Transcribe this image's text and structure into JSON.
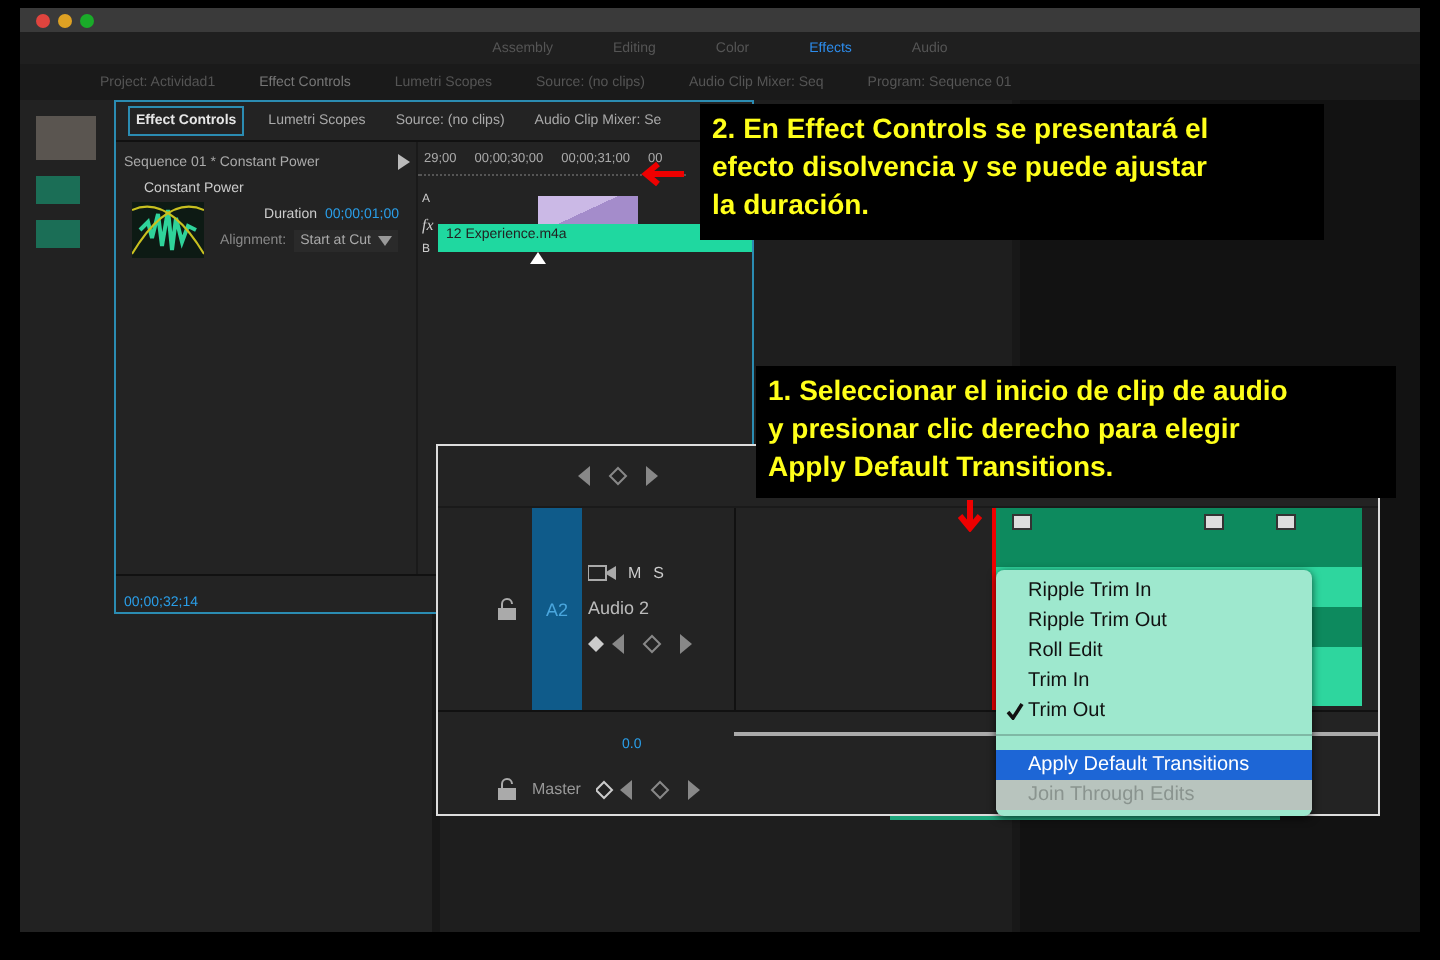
{
  "workspace_tabs": [
    {
      "label": "Assembly",
      "selected": false
    },
    {
      "label": "Editing",
      "selected": false
    },
    {
      "label": "Color",
      "selected": false
    },
    {
      "label": "Effects",
      "selected": true
    },
    {
      "label": "Audio",
      "selected": false
    }
  ],
  "background_tabs": [
    {
      "label": "Project: Actividad1",
      "selected": false
    },
    {
      "label": "Effect Controls",
      "selected": true
    },
    {
      "label": "Lumetri Scopes",
      "selected": false
    },
    {
      "label": "Source: (no clips)",
      "selected": false
    },
    {
      "label": "Audio Clip Mixer: Seq",
      "selected": false
    },
    {
      "label": "Program: Sequence 01",
      "selected": false
    }
  ],
  "effect_controls": {
    "tabs": [
      {
        "label": "Effect Controls",
        "selected": true
      },
      {
        "label": "Lumetri Scopes",
        "selected": false
      },
      {
        "label": "Source: (no clips)",
        "selected": false
      },
      {
        "label": "Audio Clip Mixer: Se",
        "selected": false
      }
    ],
    "sequence": "Sequence 01 * Constant Power",
    "ruler": [
      "29;00",
      "00;00;30;00",
      "00;00;31;00",
      "00"
    ],
    "effect_name": "Constant Power",
    "duration_label": "Duration",
    "duration": "00;00;01;00",
    "alignment_label": "Alignment:",
    "alignment": "Start at Cut",
    "track_labels": [
      "A",
      "fx",
      "B"
    ],
    "clip": "12 Experience.m4a",
    "timecode": "00;00;32;14"
  },
  "timeline": {
    "track_id": "A2",
    "track_name": "Audio 2",
    "toggles": [
      "M",
      "S"
    ],
    "master_value": "0.0",
    "master_name": "Master"
  },
  "context_menu": [
    {
      "label": "Ripple Trim In",
      "checked": false,
      "selected": false,
      "disabled": false
    },
    {
      "label": "Ripple Trim Out",
      "checked": false,
      "selected": false,
      "disabled": false
    },
    {
      "label": "Roll Edit",
      "checked": false,
      "selected": false,
      "disabled": false
    },
    {
      "label": "Trim In",
      "checked": false,
      "selected": false,
      "disabled": false
    },
    {
      "label": "Trim Out",
      "checked": true,
      "selected": false,
      "disabled": false
    },
    {
      "label": "Apply Default Transitions",
      "checked": false,
      "selected": true,
      "disabled": false
    },
    {
      "label": "Join Through Edits",
      "checked": false,
      "selected": false,
      "disabled": true
    }
  ],
  "callouts": [
    "2. En Effect Controls se presentará el\nefecto disolvencia y se puede ajustar\nla duración.",
    "1. Seleccionar el inicio de clip de audio\ny presionar clic derecho para elegir\nApply Default Transitions."
  ]
}
